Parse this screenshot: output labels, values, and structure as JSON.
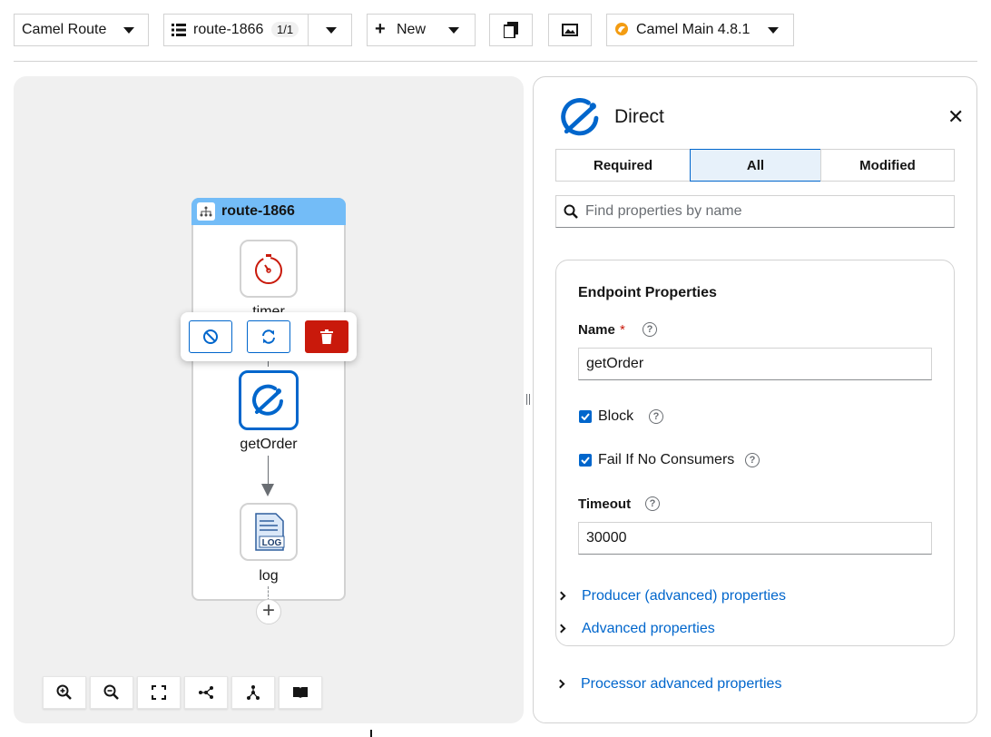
{
  "toolbar": {
    "type_select": "Camel Route",
    "route_select": "route-1866",
    "route_count": "1/1",
    "new_label": "New",
    "runtime_select": "Camel Main 4.8.1"
  },
  "canvas": {
    "route_name": "route-1866",
    "nodes": [
      {
        "label": "timer",
        "icon": "timer-icon"
      },
      {
        "label": "getOrder",
        "icon": "direct-icon"
      },
      {
        "label": "log",
        "icon": "log-icon"
      }
    ],
    "zoom_controls": [
      "zoom-in-icon",
      "zoom-out-icon",
      "fit-icon",
      "horizontal-layout-icon",
      "vertical-layout-icon",
      "legend-icon"
    ]
  },
  "panel": {
    "title": "Direct",
    "tabs": [
      "Required",
      "All",
      "Modified"
    ],
    "selected_tab": "All",
    "search_placeholder": "Find properties by name",
    "section_title": "Endpoint Properties",
    "name_label": "Name",
    "required_mark": "*",
    "name_value": "getOrder",
    "block_label": "Block",
    "fail_label": "Fail If No Consumers",
    "timeout_label": "Timeout",
    "timeout_value": "30000",
    "producer_advanced": "Producer (advanced) properties",
    "advanced": "Advanced properties",
    "processor_advanced": "Processor advanced properties"
  },
  "colors": {
    "accent": "#0066cc",
    "route_header": "#73bcf7",
    "delete": "#c9190b",
    "timer": "#c9190b"
  }
}
